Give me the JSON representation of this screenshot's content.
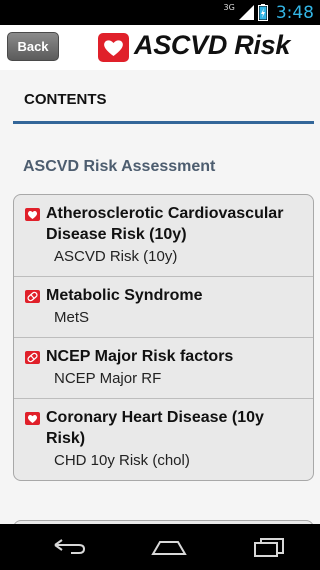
{
  "status_bar": {
    "network": "3G",
    "time": "3:48"
  },
  "header": {
    "back_label": "Back",
    "app_title": "ASCVD Risk"
  },
  "contents": {
    "title": "CONTENTS"
  },
  "group": {
    "header": "ASCVD Risk Assessment"
  },
  "items": [
    {
      "title": "Atherosclerotic Cardiovascular Disease Risk (10y)",
      "subtitle": "ASCVD Risk (10y)",
      "icon": "heart-icon"
    },
    {
      "title": "Metabolic Syndrome",
      "subtitle": "MetS",
      "icon": "pill-icon"
    },
    {
      "title": "NCEP Major Risk factors",
      "subtitle": "NCEP Major RF",
      "icon": "pill-icon"
    },
    {
      "title": "Coronary Heart Disease (10y Risk)",
      "subtitle": "CHD 10y Risk (chol)",
      "icon": "heart-icon"
    }
  ],
  "colors": {
    "accent": "#336699",
    "brand": "#e0202a",
    "status_time": "#33b5e5"
  }
}
